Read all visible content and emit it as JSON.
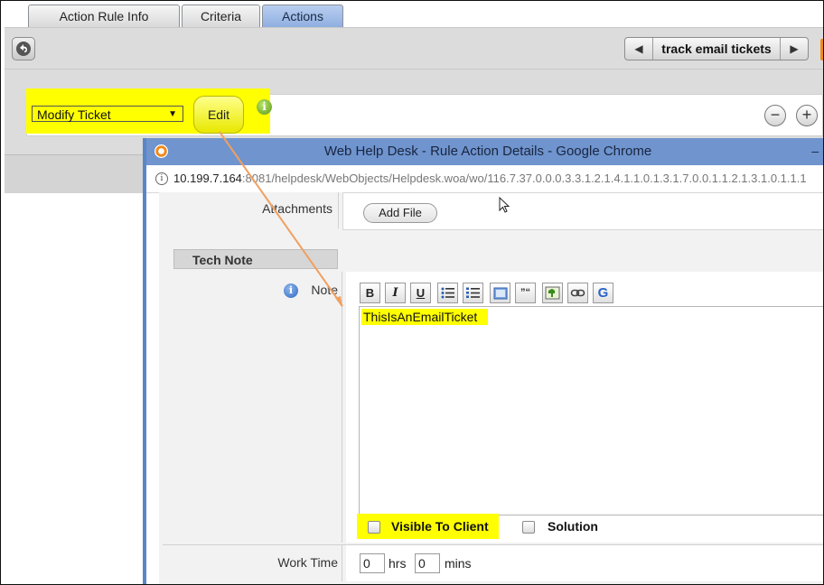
{
  "tabs": [
    {
      "label": "Action Rule Info",
      "active": false
    },
    {
      "label": "Criteria",
      "active": false
    },
    {
      "label": "Actions",
      "active": true
    }
  ],
  "pager": {
    "prev_icon": "triangle-left-icon",
    "label": "track email tickets",
    "next_icon": "triangle-right-icon"
  },
  "action": {
    "selected": "Modify Ticket",
    "edit_label": "Edit",
    "info_icon": "info-green-icon",
    "remove_icon": "minus-icon",
    "add_icon": "plus-icon"
  },
  "popup": {
    "title": "Web Help Desk - Rule Action Details - Google Chrome",
    "url_host": "10.199.7.164",
    "url_rest": ":8081/helpdesk/WebObjects/Helpdesk.woa/wo/116.7.37.0.0.0.3.3.1.2.1.4.1.1.0.1.3.1.7.0.0.1.1.2.1.3.1.0.1.1.1",
    "attachments_label": "Attachments",
    "add_file_label": "Add File",
    "tech_note_header": "Tech Note",
    "note_label": "Note",
    "toolbar": [
      {
        "name": "bold-icon",
        "glyph": "B"
      },
      {
        "name": "italic-icon",
        "glyph": "I"
      },
      {
        "name": "underline-icon",
        "glyph": "U"
      },
      {
        "name": "bulleted-list-icon",
        "glyph": ""
      },
      {
        "name": "numbered-list-icon",
        "glyph": ""
      },
      {
        "name": "frame-icon",
        "glyph": ""
      },
      {
        "name": "quote-icon",
        "glyph": "”“"
      },
      {
        "name": "image-icon",
        "glyph": ""
      },
      {
        "name": "link-icon",
        "glyph": ""
      },
      {
        "name": "google-icon",
        "glyph": "G"
      }
    ],
    "note_text": "ThisIsAnEmailTicket",
    "visible_to_client_label": "Visible To Client",
    "solution_label": "Solution",
    "work_time_label": "Work Time",
    "hours_value": "0",
    "hours_unit": "hrs",
    "minutes_value": "0",
    "minutes_unit": "mins"
  },
  "colors": {
    "highlight": "#ffff00",
    "titlebar": "#6f94ce",
    "active_tab": "#9bb8e6",
    "arrow": "#f0a060"
  }
}
